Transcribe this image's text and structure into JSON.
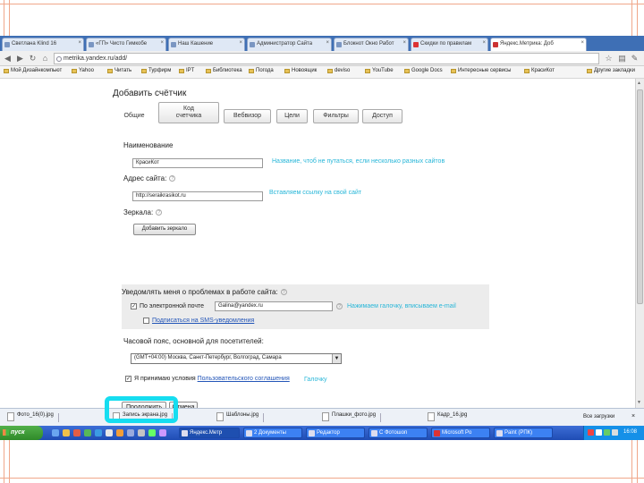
{
  "tabs": [
    {
      "label": "Светлана Klind 16"
    },
    {
      "label": "«ГП» Чисто Гимкобе"
    },
    {
      "label": "Наш Кашение"
    },
    {
      "label": "Администратор Сайта"
    },
    {
      "label": "Блокнот Окно Работ"
    },
    {
      "label": "Скидки по правилам"
    },
    {
      "label": "Яндекс.Метрика: Доб",
      "active": true
    }
  ],
  "address": {
    "url": "metrika.yandex.ru/add/"
  },
  "bookmarks": [
    {
      "label": "Мой Дизайнкомпьют"
    },
    {
      "label": "Yahoo"
    },
    {
      "label": "Читать"
    },
    {
      "label": "Турфирм"
    },
    {
      "label": "IPT"
    },
    {
      "label": "Библиотека"
    },
    {
      "label": "Погода"
    },
    {
      "label": "Новоящик"
    },
    {
      "label": "deviso"
    },
    {
      "label": "YouTube"
    },
    {
      "label": "Google Docs"
    },
    {
      "label": "Интересные сервисы"
    },
    {
      "label": "КрасиКот"
    },
    {
      "label": "Другие закладки"
    }
  ],
  "page": {
    "title": "Добавить счётчик",
    "tabs": [
      {
        "label": "Общие"
      },
      {
        "label": "Код\nсчетчика"
      },
      {
        "label": "Вебвизор"
      },
      {
        "label": "Цели"
      },
      {
        "label": "Фильтры"
      },
      {
        "label": "Доступ"
      }
    ],
    "name": {
      "label": "Наименование",
      "value": "КрасиКот",
      "hint": "Название, чтоб не путаться, если несколько разных сайтов"
    },
    "site": {
      "label": "Адрес сайта:",
      "value": "http://seraikrasikot.ru",
      "hint": "Вставляем ссылку на свой сайт"
    },
    "mirrors": {
      "label": "Зеркала:",
      "button": "Добавить зеркало"
    },
    "notify": {
      "title": "Уведомлять меня о проблемах в работе сайта:",
      "email_label": "По электронной почте",
      "email_value": "Galina@yandex.ru",
      "email_hint": "Нажимаем галочку, вписываем e-mail",
      "sms_link": "Подписаться на SMS-уведомления"
    },
    "timezone": {
      "label": "Часовой пояс, основной для посетителей:",
      "value": "(GMT+04:00) Москва, Санкт-Петербург, Волгоград, Самара"
    },
    "agree": {
      "prefix": "Я принимаю условия",
      "link": "Пользовательского соглашения",
      "hint": "Галочку"
    },
    "buttons": {
      "continue": "Продолжить",
      "cancel": "Отмена"
    }
  },
  "downloads": [
    {
      "label": "Фото_16(0).jpg"
    },
    {
      "label": "Запись экрана.jpg"
    },
    {
      "label": "Шаблоны.jpg"
    },
    {
      "label": "Плашки_фото.jpg"
    },
    {
      "label": "Кадр_16.jpg"
    }
  ],
  "downloads_all": "Все загрузки",
  "taskbar": {
    "start": "пуск",
    "tasks": [
      {
        "label": "Яндекс.Метр",
        "active": true
      },
      {
        "label": "2 Документы"
      },
      {
        "label": "Редактор"
      },
      {
        "label": "С Фотошоп"
      },
      {
        "label": "Microsoft Po"
      },
      {
        "label": "Paint (РПК)"
      }
    ],
    "time": "16:08"
  },
  "colors": {
    "accent": "#27b6d8",
    "highlight": "#16ddf0",
    "taskbar": "#2459c4"
  }
}
